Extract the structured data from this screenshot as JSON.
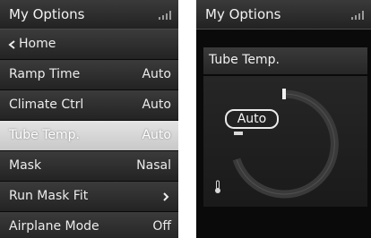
{
  "left_screen": {
    "header": {
      "title": "My Options"
    },
    "menu": [
      {
        "label": "Home",
        "value": ""
      },
      {
        "label": "Ramp Time",
        "value": "Auto"
      },
      {
        "label": "Climate Ctrl",
        "value": "Auto"
      },
      {
        "label": "Tube Temp.",
        "value": "Auto",
        "selected": true
      },
      {
        "label": "Mask",
        "value": "Nasal"
      },
      {
        "label": "Run Mask Fit",
        "value": ""
      },
      {
        "label": "Airplane Mode",
        "value": "Off"
      }
    ]
  },
  "right_screen": {
    "header": {
      "title": "My Options"
    },
    "parameter": {
      "title": "Tube Temp.",
      "value": "Auto"
    }
  },
  "icons": {
    "signal": "signal-strength-icon",
    "back": "chevron-left-icon",
    "forward": "chevron-right-icon",
    "thermometer": "thermometer-icon"
  }
}
